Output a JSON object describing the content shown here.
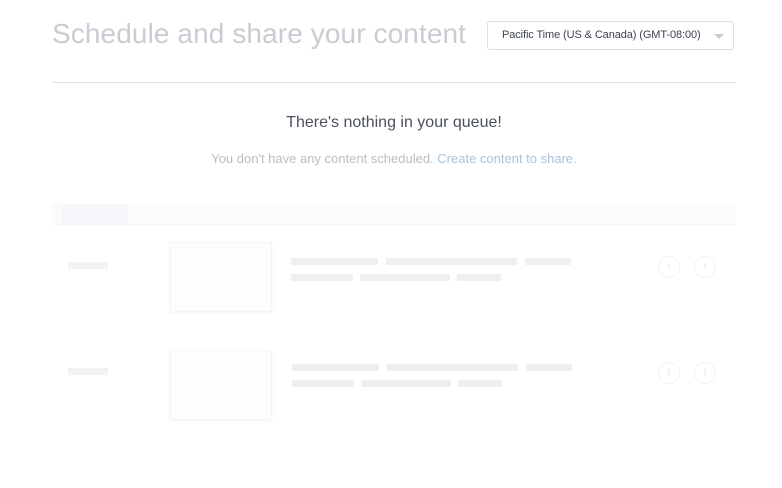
{
  "header": {
    "title": "Schedule and share your content",
    "timezone": {
      "selected": "Pacific Time (US & Canada) (GMT-08:00)"
    }
  },
  "empty_state": {
    "heading": "There's nothing in your queue!",
    "message_prefix": "You don't have any content scheduled. ",
    "link_text": "Create content to share."
  },
  "placeholder_rows": [
    {
      "network_icons": [
        "facebook-icon",
        "twitter-icon"
      ]
    },
    {
      "network_icons": [
        "facebook-icon",
        "twitter-icon"
      ]
    }
  ],
  "colors": {
    "title": "#c9ccd2",
    "heading": "#4a515c",
    "muted": "#b9bdc4",
    "link": "#a7c4dc",
    "divider": "#dfe2e6"
  }
}
